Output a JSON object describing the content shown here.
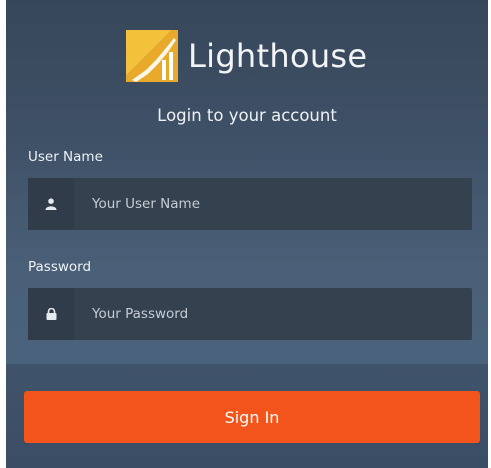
{
  "brand": {
    "name": "Lighthouse",
    "logo_icon": "lighthouse-logo-icon",
    "logo_color": "#f4c23a"
  },
  "form": {
    "title": "Login to your account",
    "username": {
      "label": "User Name",
      "placeholder": "Your User Name",
      "value": "",
      "icon": "user-icon"
    },
    "password": {
      "label": "Password",
      "placeholder": "Your Password",
      "value": "",
      "icon": "lock-icon"
    },
    "submit_label": "Sign In"
  },
  "colors": {
    "accent": "#f2541b",
    "panel": "#4a6078",
    "input_bg": "#34414f"
  }
}
